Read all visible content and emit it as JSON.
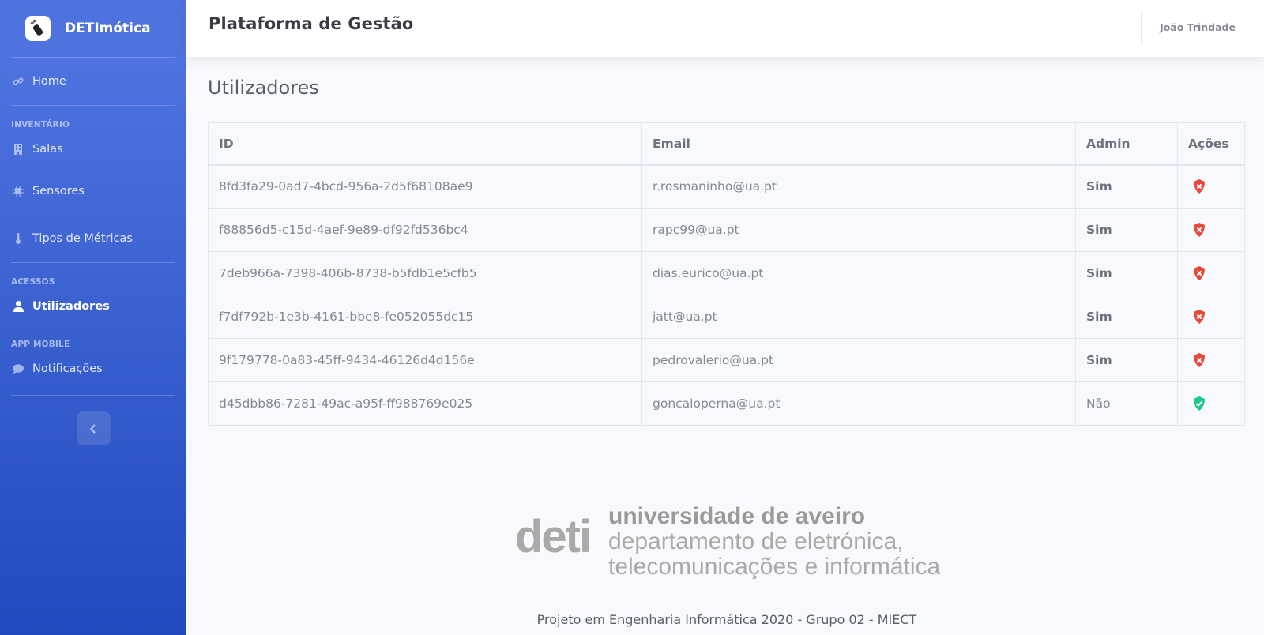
{
  "sidebar": {
    "brand": "DETImótica",
    "items": {
      "home": "Home",
      "heading_inventario": "INVENTÁRIO",
      "salas": "Salas",
      "sensores": "Sensores",
      "tipos_metricas": "Tipos de Métricas",
      "heading_acessos": "ACESSOS",
      "utilizadores": "Utilizadores",
      "heading_app_mobile": "APP MOBILE",
      "notificacoes": "Notificações"
    },
    "active_item": "Utilizadores"
  },
  "topbar": {
    "title": "Plataforma de Gestão",
    "user": "João Trindade"
  },
  "main": {
    "title": "Utilizadores",
    "table": {
      "headers": [
        "ID",
        "Email",
        "Admin",
        "Ações"
      ],
      "rows": [
        {
          "id": "8fd3fa29-0ad7-4bcd-956a-2d5f68108ae9",
          "email": "r.rosmaninho@ua.pt",
          "admin": "Sim",
          "action_icon": "shield-x-icon"
        },
        {
          "id": "f88856d5-c15d-4aef-9e89-df92fd536bc4",
          "email": "rapc99@ua.pt",
          "admin": "Sim",
          "action_icon": "shield-x-icon"
        },
        {
          "id": "7deb966a-7398-406b-8738-b5fdb1e5cfb5",
          "email": "dias.eurico@ua.pt",
          "admin": "Sim",
          "action_icon": "shield-x-icon"
        },
        {
          "id": "f7df792b-1e3b-4161-bbe8-fe052055dc15",
          "email": "jatt@ua.pt",
          "admin": "Sim",
          "action_icon": "shield-x-icon"
        },
        {
          "id": "9f179778-0a83-45ff-9434-46126d4d156e",
          "email": "pedrovalerio@ua.pt",
          "admin": "Sim",
          "action_icon": "shield-x-icon"
        },
        {
          "id": "d45dbb86-7281-49ac-a95f-ff988769e025",
          "email": "goncaloperna@ua.pt",
          "admin": "Não",
          "action_icon": "shield-check-icon"
        }
      ]
    }
  },
  "footer": {
    "logo_mark": "deti",
    "logo_line1": "universidade de aveiro",
    "logo_line2": "departamento de eletrónica,",
    "logo_line3": "telecomunicações e informática",
    "text": "Projeto em Engenharia Informática 2020 - Grupo 02 - MIECT"
  },
  "colors": {
    "sidebar_top": "#4e73df",
    "sidebar_bottom": "#224abe",
    "danger": "#e74a3b",
    "success": "#1cc88a"
  }
}
